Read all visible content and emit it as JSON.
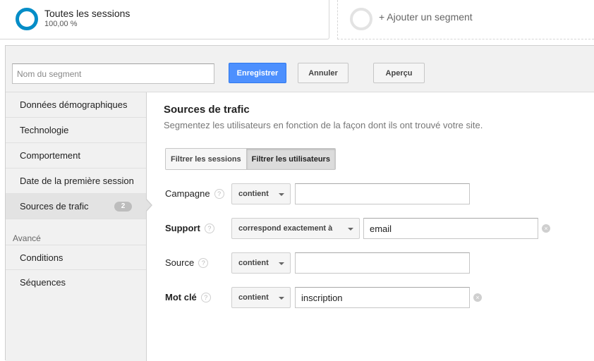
{
  "segments": {
    "current": {
      "title": "Toutes les sessions",
      "percent": "100,00 %"
    },
    "add_label": "+ Ajouter un segment"
  },
  "toolbar": {
    "name_placeholder": "Nom du segment",
    "save_label": "Enregistrer",
    "cancel_label": "Annuler",
    "preview_label": "Aperçu"
  },
  "sidebar": {
    "items": [
      {
        "label": "Données démographiques"
      },
      {
        "label": "Technologie"
      },
      {
        "label": "Comportement"
      },
      {
        "label": "Date de la première session"
      },
      {
        "label": "Sources de trafic",
        "badge": "2",
        "active": true
      }
    ],
    "advanced_heading": "Avancé",
    "advanced_items": [
      {
        "label": "Conditions"
      },
      {
        "label": "Séquences"
      }
    ]
  },
  "main": {
    "title": "Sources de trafic",
    "subtitle": "Segmentez les utilisateurs en fonction de la façon dont ils ont trouvé votre site.",
    "filter_toggle": {
      "sessions_label": "Filtrer les sessions",
      "users_label": "Filtrer les utilisateurs",
      "selected": "Filtrer les utilisateurs"
    },
    "help_glyph": "?",
    "clear_glyph": "×",
    "rows": [
      {
        "label": "Campagne",
        "operator": "contient",
        "value": ""
      },
      {
        "label": "Support",
        "operator": "correspond exactement à",
        "value": "email"
      },
      {
        "label": "Source",
        "operator": "contient",
        "value": ""
      },
      {
        "label": "Mot clé",
        "operator": "contient",
        "value": "inscription"
      }
    ]
  },
  "colors": {
    "accent_blue": "#4d90fe",
    "segment_ring": "#058dc7"
  }
}
